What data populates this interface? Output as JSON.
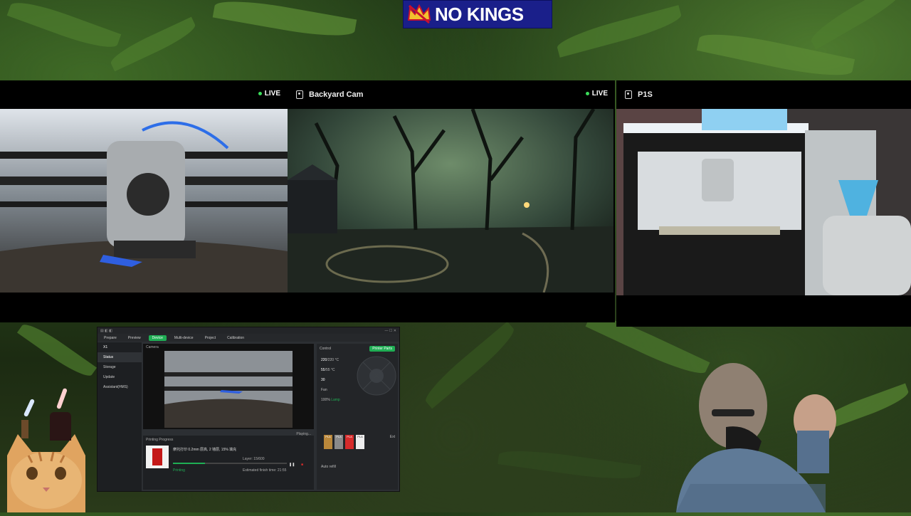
{
  "banner": {
    "text": "NO KINGS"
  },
  "cameras": [
    {
      "name": "",
      "live_label": "LIVE",
      "show_live": true
    },
    {
      "name": "Backyard Cam",
      "live_label": "LIVE",
      "show_live": true
    },
    {
      "name": "P1S",
      "live_label": "",
      "show_live": false
    }
  ],
  "app": {
    "tabs": [
      "Prepare",
      "Preview",
      "Device",
      "Multi-device",
      "Project",
      "Calibration"
    ],
    "active_tab": "Device",
    "device_name": "X1",
    "sidebar": [
      "Status",
      "Storage",
      "Update",
      "Assistant(HMS)"
    ],
    "camera_label": "Camera",
    "camera_status": "Playing...",
    "printing_progress_label": "Printing Progress",
    "print_file": "摩托打印 0.2mm 层高, 2 墙层, 15% 填充",
    "printing_status": "Printing",
    "layer_info": "Layer: 15/600",
    "estimated_finish": "Estimated finish time: 21:55",
    "control_label": "Control",
    "printer_parts_label": "Printer Parts",
    "nozzle_temp": "220",
    "nozzle_target": "/220 °C",
    "bed_temp": "55",
    "bed_target": "/55 °C",
    "chamber_temp": "30",
    "fan_label": "Fan",
    "speed_value": "100%",
    "speed_label": "Lamp",
    "ext_label": "Ext",
    "auto_refill": "Auto refill",
    "ams_slots": [
      {
        "label": "PLA",
        "color": "#b9873a"
      },
      {
        "label": "PLA",
        "color": "#8a8a8a"
      },
      {
        "label": "PLA",
        "color": "#d62b2b"
      },
      {
        "label": "PLA",
        "color": "#eeeeee"
      }
    ]
  },
  "colors": {
    "live_dot": "#3bdc5a",
    "accent_green": "#1fae54",
    "banner_blue": "#1a1f8a"
  }
}
